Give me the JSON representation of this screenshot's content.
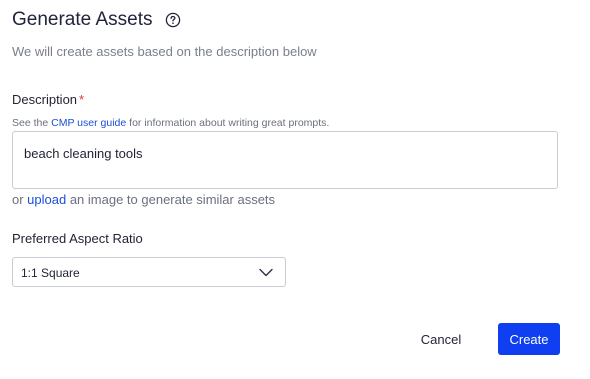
{
  "header": {
    "title": "Generate Assets",
    "subtitle": "We will create assets based on the description below"
  },
  "description": {
    "label": "Description",
    "required_marker": "*",
    "hint_prefix": "See the ",
    "hint_link": "CMP user guide",
    "hint_suffix": " for information about writing great prompts.",
    "value": "beach cleaning tools"
  },
  "upload": {
    "prefix": "or ",
    "link": "upload",
    "suffix": " an image to generate similar assets"
  },
  "aspect_ratio": {
    "label": "Preferred Aspect Ratio",
    "selected": "1:1 Square"
  },
  "actions": {
    "cancel_label": "Cancel",
    "create_label": "Create"
  },
  "colors": {
    "accent": "#0f3ff0",
    "link": "#1b4fd8",
    "required": "#e0333a"
  },
  "icons": {
    "help": "question-circle-icon",
    "select_chevron": "chevron-down-icon"
  }
}
